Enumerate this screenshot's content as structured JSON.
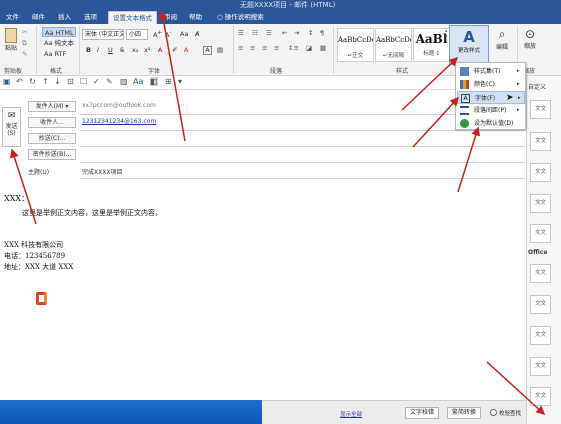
{
  "window": {
    "title": "无题XXXX项目 - 邮件 (HTML)"
  },
  "tabs": [
    "文件",
    "邮件",
    "插入",
    "选项",
    "设置文本格式",
    "审阅",
    "帮助",
    "操作说明搜索"
  ],
  "ribbon": {
    "clipboard": {
      "paste_label": "粘贴",
      "group_label": "剪贴板"
    },
    "format": {
      "items": [
        "Aa HTML",
        "Aa 纯文本",
        "Aa RTF"
      ],
      "group_label": "格式"
    },
    "font": {
      "name": "宋体 (中文正文)",
      "size": "小四",
      "group_label": "字体"
    },
    "paragraph": {
      "group_label": "段落"
    },
    "styles": {
      "cards": [
        {
          "sample": "AaBbCcDc",
          "name": "↵正文"
        },
        {
          "sample": "AaBbCcDc",
          "name": "↵无间隔"
        },
        {
          "sample": "AaBl",
          "name": "标题 1"
        }
      ],
      "group_label": "样式",
      "change_styles_label": "更改样式"
    },
    "editing": {
      "label": "编辑"
    },
    "zoom": {
      "label": "缩放",
      "group_label": "缩放"
    }
  },
  "dropdown": {
    "items": [
      {
        "label": "样式集(T)",
        "icon": "style-set-icon"
      },
      {
        "label": "颜色(C)",
        "icon": "palette-icon"
      },
      {
        "label": "字体(F)",
        "icon": "font-icon"
      },
      {
        "label": "段落间距(P)",
        "icon": "spacing-icon"
      },
      {
        "label": "设为默认值(D)",
        "icon": "check-circle-icon"
      }
    ]
  },
  "compose": {
    "send": {
      "label": "发送",
      "sub": "(S)"
    },
    "from_button": "发件人(M) ▾",
    "from_value": "xx7pccom@outlook.com",
    "to_button": "收件人...",
    "to_value": "12312341234@163.com",
    "cc_button": "抄送(C)...",
    "bcc_button": "密件抄送(B)...",
    "subject_label": "主题(U)",
    "subject_value": "完成XXXX项目"
  },
  "body": {
    "greeting": "XXX：",
    "line1": "这里是举例正文内容，这里是举例正文内容，",
    "company": "XXX 科技有限公司",
    "phone": "电话：123456789",
    "address": "地址：XXX 大道 XXX"
  },
  "style_pane": {
    "head1": "自定义",
    "head2": "Office",
    "box_label": "文文"
  },
  "status": {
    "button1": "文字校错",
    "button2": "繁简转换",
    "option": "校验查找",
    "link": "显示全部"
  },
  "colors": {
    "brand": "#2b579a",
    "ribbon": "#f3f3f3",
    "arrow": "#cc1f1f"
  }
}
